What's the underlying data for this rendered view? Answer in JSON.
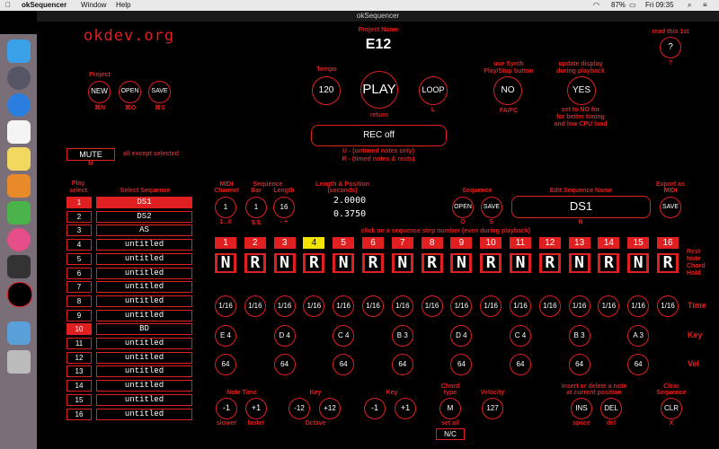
{
  "menubar": {
    "app": "okSequencer",
    "window": "Window",
    "help": "Help",
    "battery": "87%",
    "clock": "Fri 09:35"
  },
  "window_title": "okSequencer",
  "logo": "okdev.org",
  "project": {
    "label": "Project Name",
    "name": "E12",
    "section_label": "Project",
    "new": "NEW",
    "open": "OPEN",
    "save": "SAVE",
    "new_sc": "⌘N",
    "open_sc": "⌘O",
    "save_sc": "⌘S"
  },
  "tempo": {
    "label": "Tempo",
    "value": "120"
  },
  "play": {
    "label": "PLAY",
    "sub": "return"
  },
  "loop": {
    "label": "LOOP",
    "sub": "L"
  },
  "rec": {
    "label": "REC off",
    "help1": "U - (untimed notes only)",
    "help2": "R - (timed notes & rests)"
  },
  "synth": {
    "label1": "use Synth",
    "label2": "Play/Stop button",
    "value": "NO",
    "sub": "FA/FC"
  },
  "display": {
    "label1": "update display",
    "label2": "during playback",
    "value": "YES",
    "note1": "set to NO for",
    "note2": "for better timing",
    "note3": "and low CPU load"
  },
  "help": {
    "label": "read this 1st",
    "btn": "?",
    "sub": "?"
  },
  "mute": {
    "label": "MUTE",
    "desc": "all except selected",
    "sub": "M"
  },
  "sequence_list": {
    "play_label1": "Play",
    "play_label2": "select",
    "select_label": "Select Sequence",
    "rows": [
      {
        "num": "1",
        "name": "DS1"
      },
      {
        "num": "2",
        "name": "DS2"
      },
      {
        "num": "3",
        "name": "AS"
      },
      {
        "num": "4",
        "name": "untitled"
      },
      {
        "num": "5",
        "name": "untitled"
      },
      {
        "num": "6",
        "name": "untitled"
      },
      {
        "num": "7",
        "name": "untitled"
      },
      {
        "num": "8",
        "name": "untitled"
      },
      {
        "num": "9",
        "name": "untitled"
      },
      {
        "num": "10",
        "name": "BD"
      },
      {
        "num": "11",
        "name": "untitled"
      },
      {
        "num": "12",
        "name": "untitled"
      },
      {
        "num": "13",
        "name": "untitled"
      },
      {
        "num": "14",
        "name": "untitled"
      },
      {
        "num": "15",
        "name": "untitled"
      },
      {
        "num": "16",
        "name": "untitled"
      }
    ]
  },
  "midi": {
    "channel_label1": "MIDI",
    "channel_label2": "Channel",
    "channel": "1",
    "channel_sub": "1...0",
    "bar_label1": "Sequence",
    "bar_label2": "Bar",
    "bar": "1",
    "bar_sub": "⇅⇅",
    "length_label": "Length",
    "length": "16",
    "length_sub": "-  +"
  },
  "lengthpos": {
    "label1": "Length & Position",
    "label2": "(seconds)",
    "length": "2.0000",
    "position": "0.3750"
  },
  "seq_io": {
    "label": "Sequence",
    "open": "OPEN",
    "save": "SAVE",
    "open_sub": "O",
    "save_sub": "S"
  },
  "edit_name": {
    "label": "Edit Sequence Name",
    "value": "DS1",
    "sub": "N"
  },
  "export": {
    "label1": "Export as",
    "label2": "MIDI",
    "btn": "SAVE"
  },
  "steps_hint": "click on a sequence step number (even during playback)",
  "steps": [
    "1",
    "2",
    "3",
    "4",
    "5",
    "6",
    "7",
    "8",
    "9",
    "10",
    "11",
    "12",
    "13",
    "14",
    "15",
    "16"
  ],
  "notes": [
    "N",
    "R",
    "N",
    "R",
    "N",
    "R",
    "N",
    "R",
    "N",
    "R",
    "N",
    "R",
    "N",
    "R",
    "N",
    "R"
  ],
  "legend": {
    "rest": "Rest",
    "note": "Note",
    "chord": "Chord",
    "hold": "Hold"
  },
  "times": [
    "1/16",
    "1/16",
    "1/16",
    "1/16",
    "1/16",
    "1/16",
    "1/16",
    "1/16",
    "1/16",
    "1/16",
    "1/16",
    "1/16",
    "1/16",
    "1/16",
    "1/16",
    "1/16"
  ],
  "keys": [
    "E 4",
    "D 4",
    "C 4",
    "B 3",
    "D 4",
    "C 4",
    "B 3",
    "A 3"
  ],
  "vels": [
    "64",
    "64",
    "64",
    "64",
    "64",
    "64",
    "64",
    "64"
  ],
  "row_labels": {
    "time": "Time",
    "key": "Key",
    "vel": "Vel"
  },
  "bottom": {
    "note_time": "Note Time",
    "nt_minus": "-1",
    "nt_plus": "+1",
    "slower": "slower",
    "faster": "faster",
    "key_oct": "Key",
    "oct_minus": "-12",
    "oct_plus": "+12",
    "octave": "Octave",
    "key": "Key",
    "k_minus": "-1",
    "k_plus": "+1",
    "chord_label1": "Chord",
    "chord_label2": "type",
    "chord": "M",
    "set_all": "set all",
    "nc": "N/C",
    "velocity": "Velocity",
    "vel_value": "127",
    "ins_label1": "insert or delete a note",
    "ins_label2": "at current position",
    "ins": "INS",
    "del": "DEL",
    "space": "space",
    "del_sub": "del",
    "clear_label1": "Clear",
    "clear_label2": "Sequence",
    "clr": "CLR",
    "clr_sub": "X"
  }
}
